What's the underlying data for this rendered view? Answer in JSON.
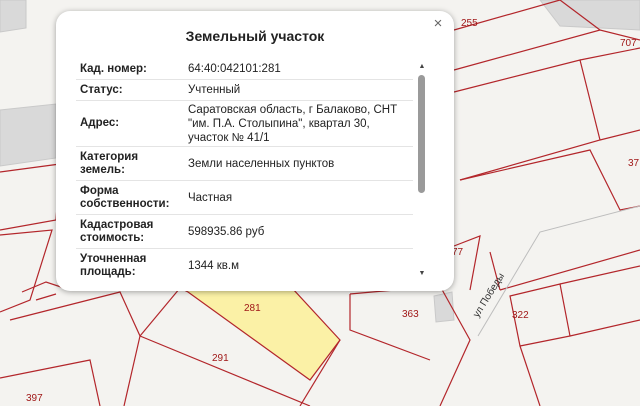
{
  "map": {
    "parcel_numbers": [
      "255",
      "707",
      "37",
      "77",
      "322",
      "363",
      "281",
      "291",
      "397"
    ],
    "street_name": "ул Победы",
    "colors": {
      "boundary": "#b3262b",
      "selected_fill": "#fbf1a6",
      "background": "#f4f3f0",
      "building": "#d9d9d9"
    }
  },
  "popup": {
    "title": "Земельный участок",
    "rows": [
      {
        "label": "Кад. номер:",
        "value": "64:40:042101:281"
      },
      {
        "label": "Статус:",
        "value": "Учтенный"
      },
      {
        "label": "Адрес:",
        "value": "Саратовская область, г Балаково, СНТ \"им. П.А. Столыпина\", квартал 30, участок № 41/1"
      },
      {
        "label": "Категория земель:",
        "value": "Земли населенных пунктов"
      },
      {
        "label": "Форма собственности:",
        "value": "Частная"
      },
      {
        "label": "Кадастровая стоимость:",
        "value": "598935.86 руб"
      },
      {
        "label": "Уточненная площадь:",
        "value": "1344 кв.м"
      }
    ],
    "close_icon": "×"
  }
}
